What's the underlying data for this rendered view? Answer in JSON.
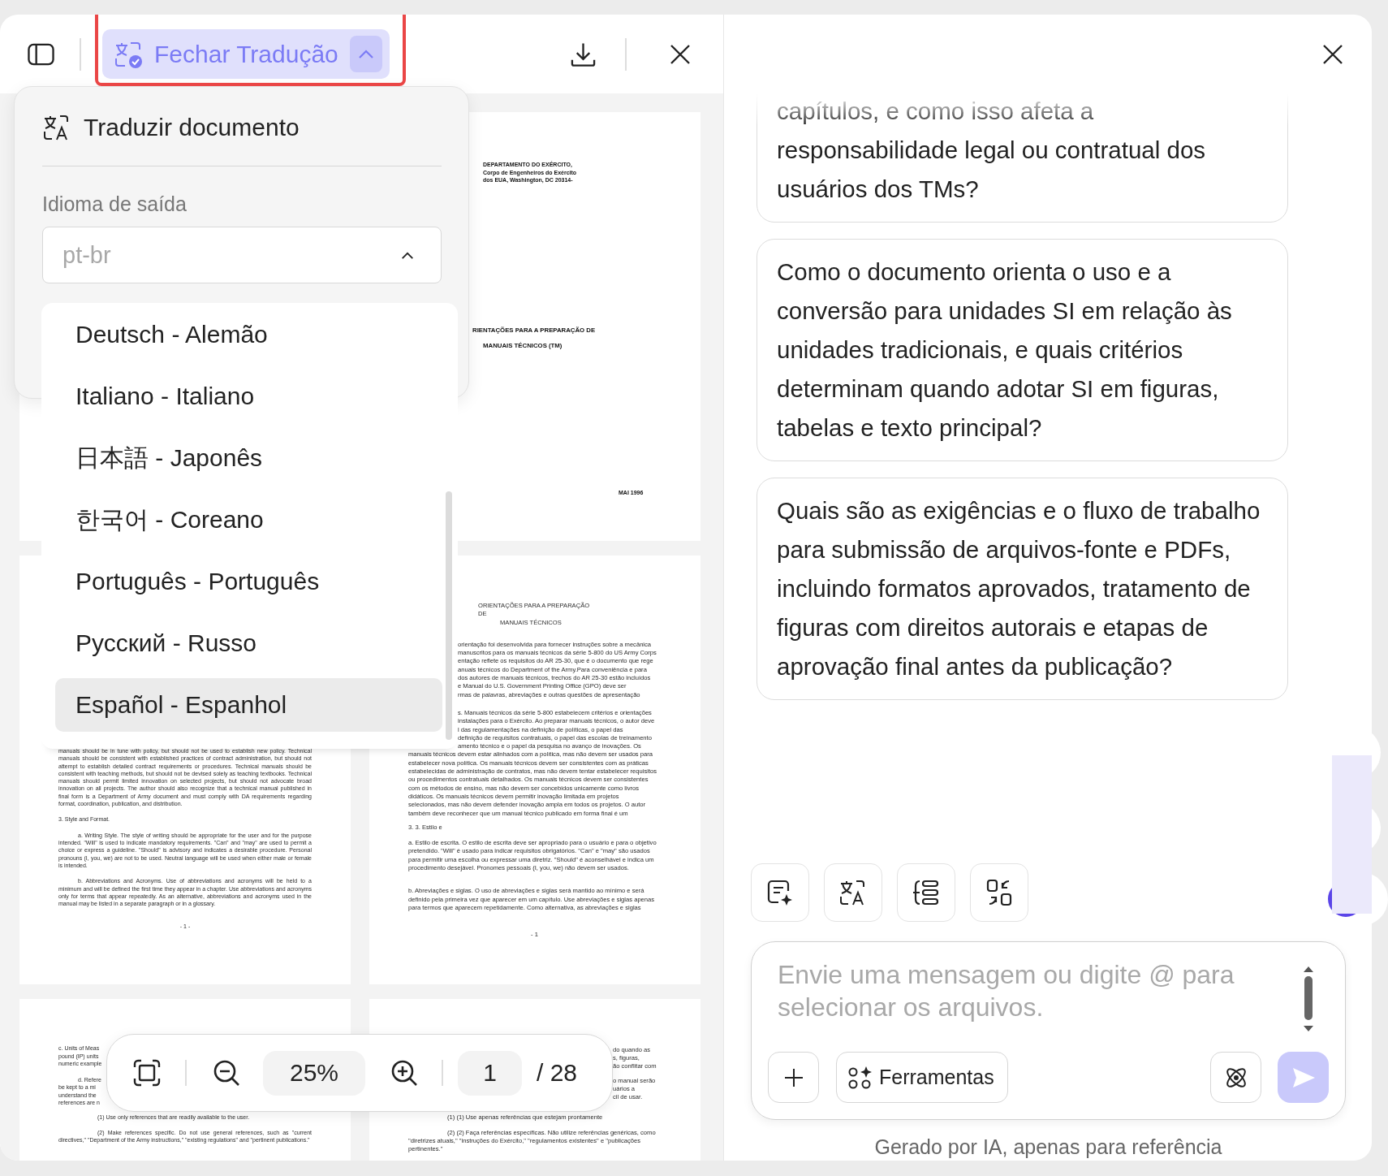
{
  "header": {
    "translate_button": "Fechar Tradução",
    "expanded": true
  },
  "translate_panel": {
    "title": "Traduzir documento",
    "output_label": "Idioma de saída",
    "output_value": "pt-br",
    "expanded": true
  },
  "language_options": [
    {
      "label": "Deutsch - Alemão",
      "hovered": false
    },
    {
      "label": "Italiano - Italiano",
      "hovered": false
    },
    {
      "label": "日本語 - Japonês",
      "hovered": false
    },
    {
      "label": "한국어 - Coreano",
      "hovered": false
    },
    {
      "label": "Português - Português",
      "hovered": false
    },
    {
      "label": "Русский - Russo",
      "hovered": false
    },
    {
      "label": "Español - Espanhol",
      "hovered": true
    }
  ],
  "pages": [
    {
      "kind": "covered"
    },
    {
      "kind": "page",
      "blocks": [
        {
          "kind": "bold",
          "text": "DEPARTAMENTO DO EXÉRCITO,"
        },
        {
          "kind": "bold",
          "text": "Corpo de Engenheiros do Exército"
        },
        {
          "kind": "bold",
          "text": "dos EUA, Washington, DC 20314-"
        },
        {
          "kind": "title",
          "text": "RIENTAÇÕES PARA A PREPARAÇÃO DE"
        },
        {
          "kind": "title",
          "text": "MANUAIS TÉCNICOS (TM)"
        },
        {
          "kind": "bold",
          "text": "MAI 1996"
        }
      ]
    },
    {
      "kind": "page",
      "blocks": [
        {
          "kind": "para",
          "text": "manuals should be in tune with policy, but should not be used to establish new policy. Technical manuals should be consistent with established practices of contract administration, but should not attempt to establish detailed contract requirements or procedures. Technical manuals should be consistent with teaching methods, but should not be devised solely as teaching textbooks. Technical manuals should permit limited innovation on selected projects, but should not advocate broad innovation on all projects. The author should also recognize that a technical manual published in final form is a Department of Army document and must comply with DA requirements regarding format, coordination, publication, and distribution."
        },
        {
          "kind": "en_line",
          "text": "3. Style and Format."
        },
        {
          "kind": "para",
          "text": "a. Writing Style. The style of writing should be appropriate for the user and for the purpose intended. \"Will\" is used to indicate mandatory requirements. \"Can\" and \"may\" are used to permit a choice or express a guideline. \"Should\" is advisory and indicates a desirable procedure. Personal pronouns (I, you, we) are not to be used. Neutral language will be used when either male or female is intended."
        },
        {
          "kind": "para",
          "text": "b. Abbreviations and Acronyms. Use of abbreviations and acronyms will be held to a minimum and will be defined the first time they appear in a chapter. Use abbreviations and acronyms only for terms that appear repeatedly. As an alternative, abbreviations and acronyms used in the manual may be listed in a separate paragraph or in a glossary."
        },
        {
          "kind": "page_number",
          "text": "- 1 -"
        }
      ]
    },
    {
      "kind": "page",
      "blocks": [
        {
          "kind": "line",
          "text": "ORIENTAÇÕES PARA A PREPARAÇÃO"
        },
        {
          "kind": "line",
          "text": "DE"
        },
        {
          "kind": "line",
          "text": "MANUAIS TÉCNICOS"
        },
        {
          "kind": "line",
          "text": "orientação foi desenvolvida para fornecer instruções sobre a mecânica"
        },
        {
          "kind": "line",
          "text": "manuscritos para os manuais técnicos da série 5-800 do US Army Corps"
        },
        {
          "kind": "line",
          "text": "entação reflete os requisitos do AR 25-30, que é o documento que rege"
        },
        {
          "kind": "line",
          "text": "anuais técnicos do Department of the Army.Para conveniência e para"
        },
        {
          "kind": "line",
          "text": "dos autores de manuais técnicos, trechos do AR 25-30 estão incluídos"
        },
        {
          "kind": "line",
          "text": "e Manual do U.S. Government Printing Office (GPO) deve ser"
        },
        {
          "kind": "line",
          "text": "rmas de palavras, abreviações e outras questões de apresentação"
        },
        {
          "kind": "line",
          "text": "s. Manuais técnicos da série 5-800 estabelecem critérios e orientações"
        },
        {
          "kind": "line",
          "text": "instalações para o Exército. Ao preparar manuais técnicos, o autor deve"
        },
        {
          "kind": "line",
          "text": "l das regulamentações na definição de políticas, o papel das"
        },
        {
          "kind": "line",
          "text": "definição de requisitos contratuais, o papel das escolas de treinamento"
        },
        {
          "kind": "line",
          "text": "amento técnico e o papel da pesquisa no avanço de inovações. Os"
        },
        {
          "kind": "line",
          "text": "manuais técnicos devem estar alinhados com a política, mas não devem ser usados para"
        },
        {
          "kind": "line",
          "text": "estabelecer nova política. Os manuais técnicos devem ser consistentes com as práticas"
        },
        {
          "kind": "line",
          "text": "estabelecidas de administração de contratos, mas não devem tentar estabelecer requisitos"
        },
        {
          "kind": "line",
          "text": "ou procedimentos contratuais detalhados. Os manuais técnicos devem ser consistentes"
        },
        {
          "kind": "line",
          "text": "com os métodos de ensino, mas não devem ser concebidos unicamente como livros"
        },
        {
          "kind": "line",
          "text": "didáticos. Os manuais técnicos devem permitir inovação limitada em projetos"
        },
        {
          "kind": "line",
          "text": "selecionados, mas não devem defender inovação ampla em todos os projetos. O autor"
        },
        {
          "kind": "line",
          "text": "também deve reconhecer que um manual técnico publicado em forma final é um"
        },
        {
          "kind": "line",
          "text": "3. 3. Estilo e"
        },
        {
          "kind": "line",
          "text": "a. Estilo de escrita. O estilo de escrita deve ser apropriado para o usuário e para o objetivo"
        },
        {
          "kind": "line",
          "text": "pretendido. \"Will\" é usado para indicar requisitos obrigatórios. \"Can\" e \"may\" são usados"
        },
        {
          "kind": "line",
          "text": "para permitir uma escolha ou expressar uma diretriz. \"Should\" é aconselhável e indica um"
        },
        {
          "kind": "line",
          "text": "procedimento desejável. Pronomes pessoais (I, you, we) não devem ser usados."
        },
        {
          "kind": "line",
          "text": "b. Abreviações e siglas. O uso de abreviações e siglas será mantido ao mínimo e será"
        },
        {
          "kind": "line",
          "text": "definido pela primeira vez que aparecer em um capítulo. Use abreviações e siglas apenas"
        },
        {
          "kind": "line",
          "text": "para termos que aparecem repetidamente. Como alternativa, as abreviações e siglas"
        },
        {
          "kind": "line",
          "text": "- 1"
        }
      ]
    },
    {
      "kind": "page",
      "blocks": [
        {
          "kind": "en_line",
          "text": "c. Units of Meas"
        },
        {
          "kind": "en_line",
          "text": "pound (IP) units"
        },
        {
          "kind": "en_line",
          "text": "numeric example"
        },
        {
          "kind": "en_line",
          "text": "d. Refere"
        },
        {
          "kind": "en_line",
          "text": "be kept to a mi"
        },
        {
          "kind": "en_line",
          "text": "understand the"
        },
        {
          "kind": "en_line",
          "text": "references are n"
        },
        {
          "kind": "en_line",
          "text": "(1) Use only references that are readily available to the user."
        },
        {
          "kind": "para",
          "text": "(2) Make references specific. Do not use general references, such as \"current directives,\" \"Department of the Army instructions,\" \"existing regulations\" and \"pertinent publications.\""
        }
      ]
    },
    {
      "kind": "page",
      "blocks": [
        {
          "kind": "line",
          "text": "do quando as"
        },
        {
          "kind": "line",
          "text": "s, figuras,"
        },
        {
          "kind": "line",
          "text": "ão conflitar com"
        },
        {
          "kind": "line",
          "text": "o manual serão"
        },
        {
          "kind": "line",
          "text": "uários a"
        },
        {
          "kind": "line",
          "text": "cil de usar."
        },
        {
          "kind": "line",
          "text": "(1) (1) Use apenas referências que estejam prontamente"
        },
        {
          "kind": "line",
          "text": "(2) (2) Faça referências específicas. Não utilize referências genéricas, como"
        },
        {
          "kind": "line",
          "text": "\"diretrizes atuais,\" \"instruções do Exército,\" \"regulamentos existentes\" e \"publicações"
        },
        {
          "kind": "line",
          "text": "pertinentes.\""
        }
      ]
    }
  ],
  "zoom_toolbar": {
    "zoom": "25%",
    "page": "1",
    "total": "/ 28"
  },
  "chat": {
    "messages": [
      "capítulos, e como isso afeta a responsabilidade legal ou contratual dos usuários dos TMs?",
      "Como o documento orienta o uso e a conversão para unidades SI em relação às unidades tradicionais, e quais critérios determinam quando adotar SI em figuras, tabelas e texto principal?",
      "Quais são as exigências e o fluxo de trabalho para submissão de arquivos-fonte e PDFs, incluindo formatos aprovados, tratamento de figuras com direitos autorais e etapas de aprovação final antes da publicação?"
    ],
    "input_placeholder": "Envie uma mensagem ou digite @ para selecionar os arquivos.",
    "tools_button": "Ferramentas",
    "footer": "Gerado por IA, apenas para referência"
  }
}
